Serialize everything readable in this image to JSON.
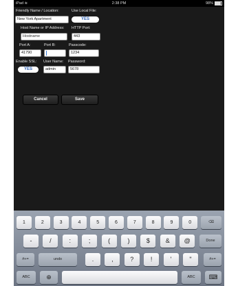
{
  "status": {
    "carrier": "iPad",
    "time": "2:38 PM",
    "battery": "98%"
  },
  "form": {
    "friendly_label": "Friendly Name / Location:",
    "friendly_value": "New York Apartment",
    "local_label": "Use Local File:",
    "local_value": "YES",
    "host_label": "Host Name or IP Address:",
    "host_value": "Hostname",
    "http_label": "HTTP Port:",
    "http_value": "443",
    "porta_label": "Port A:",
    "porta_value": "41790",
    "portb_label": "Port B:",
    "portb_value": "",
    "passcode_label": "Passcode:",
    "passcode_value": "1234",
    "ssl_label": "Enable SSL:",
    "ssl_value": "YES",
    "user_label": "User Name:",
    "user_value": "admin",
    "password_label": "Password:",
    "password_value": "5678"
  },
  "actions": {
    "cancel": "Cancel",
    "save": "Save"
  },
  "keyboard": {
    "row1": [
      "1",
      "2",
      "3",
      "4",
      "5",
      "6",
      "7",
      "8",
      "9",
      "0"
    ],
    "row2": [
      "-",
      "/",
      ":",
      ";",
      "(",
      ")",
      "$",
      "&",
      "@"
    ],
    "done": "Done",
    "shift_sym": "#+=",
    "undo": "undo",
    "row3": [
      ".",
      ",",
      "?",
      "!",
      "'",
      "\""
    ],
    "abc": "ABC",
    "icons": {
      "backspace": "backspace-icon",
      "globe": "globe-icon",
      "dismiss": "keyboard-dismiss-icon"
    }
  }
}
